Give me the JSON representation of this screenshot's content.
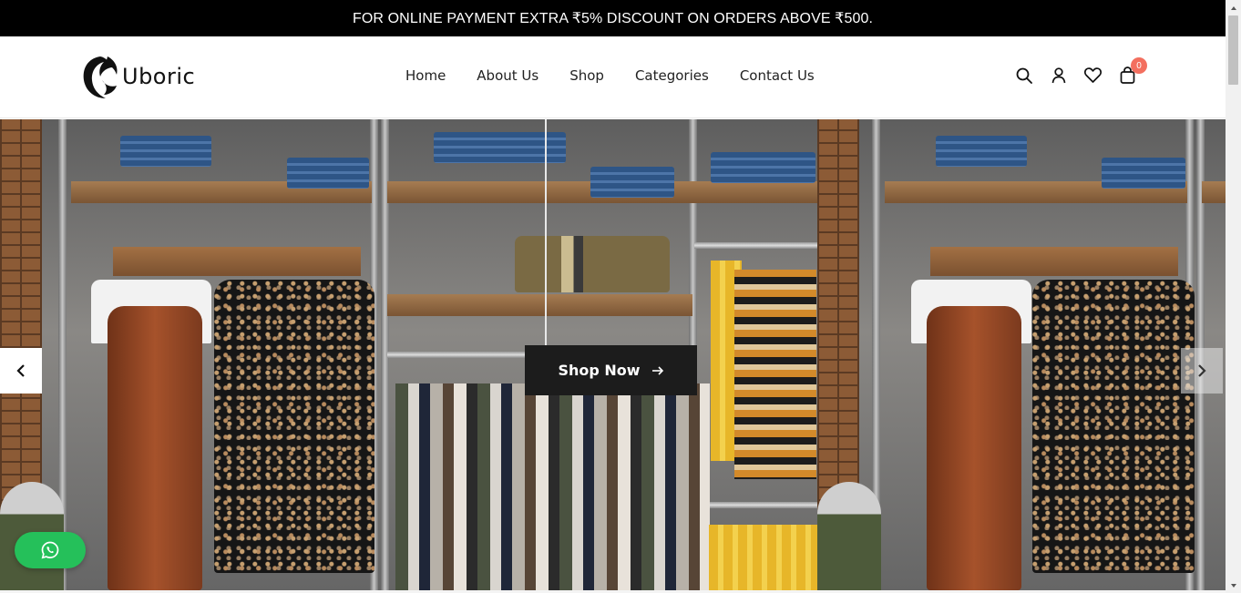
{
  "announcement": {
    "text": "FOR ONLINE PAYMENT EXTRA ₹5% DISCOUNT ON ORDERS ABOVE ₹500."
  },
  "header": {
    "logo_text": "Uboric",
    "nav": [
      "Home",
      "About Us",
      "Shop",
      "Categories",
      "Contact Us"
    ],
    "icons": [
      "search-icon",
      "user-icon",
      "heart-icon",
      "shopping-bag-icon"
    ],
    "cart_count": "0"
  },
  "hero": {
    "cta_label": "Shop Now",
    "cta_icon": "arrow-right-icon",
    "prev_icon": "chevron-left-icon",
    "next_icon": "chevron-right-icon"
  },
  "floating": {
    "whatsapp_icon": "whatsapp-icon"
  },
  "colors": {
    "announce_bg": "#000000",
    "cta_bg": "#1c1c1c",
    "badge": "#f36f5f",
    "whatsapp": "#25c05a"
  }
}
